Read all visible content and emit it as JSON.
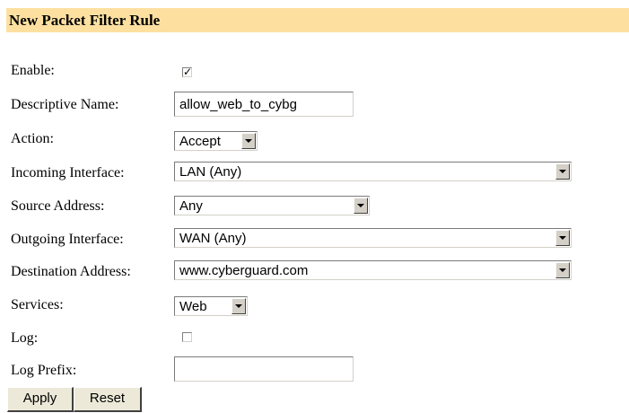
{
  "header": {
    "title": "New Packet Filter Rule"
  },
  "form": {
    "enable": {
      "label": "Enable:",
      "checked": true
    },
    "descriptive_name": {
      "label": "Descriptive Name:",
      "value": "allow_web_to_cybg"
    },
    "action": {
      "label": "Action:",
      "value": "Accept"
    },
    "incoming_interface": {
      "label": "Incoming Interface:",
      "value": "LAN (Any)"
    },
    "source_address": {
      "label": "Source Address:",
      "value": "Any"
    },
    "outgoing_interface": {
      "label": "Outgoing Interface:",
      "value": "WAN (Any)"
    },
    "destination_address": {
      "label": "Destination Address:",
      "value": "www.cyberguard.com"
    },
    "services": {
      "label": "Services:",
      "value": "Web"
    },
    "log": {
      "label": "Log:",
      "checked": false
    },
    "log_prefix": {
      "label": "Log Prefix:",
      "value": ""
    }
  },
  "buttons": {
    "apply": "Apply",
    "reset": "Reset"
  },
  "colors": {
    "header_bg": "#fde0a0",
    "button_bg": "#ece9d8"
  }
}
